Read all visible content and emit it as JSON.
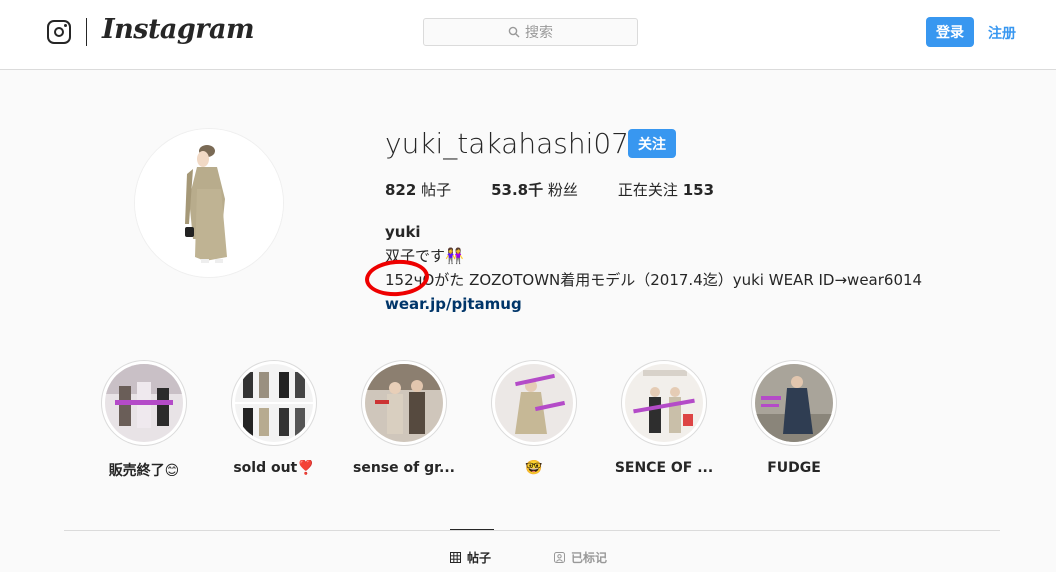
{
  "header": {
    "wordmark": "Instagram",
    "search_placeholder": "搜索",
    "login_label": "登录",
    "signup_label": "注册",
    "accent_color": "#3897f0"
  },
  "profile": {
    "username": "yuki_takahashi0706",
    "follow_label": "关注",
    "stats": {
      "posts_count": "822",
      "posts_label": "帖子",
      "followers_count": "53.8千",
      "followers_label": "粉丝",
      "following_label": "正在关注",
      "following_count": "153"
    },
    "bio": {
      "name": "yuki",
      "line1": "双子です👭",
      "line2": "152чOがた ZOZOTOWN着用モデル（2017.4迄）yuki WEAR ID→wear6014",
      "link": "wear.jp/pjtamug"
    }
  },
  "highlights": [
    {
      "label": "販売終了😊",
      "icon": "highlight-1"
    },
    {
      "label": "sold out❣️",
      "icon": "highlight-2"
    },
    {
      "label": "sense of gr...",
      "icon": "highlight-3"
    },
    {
      "label": "🤓",
      "icon": "highlight-4"
    },
    {
      "label": "SENCE OF ...",
      "icon": "highlight-5"
    },
    {
      "label": "FUDGE",
      "icon": "highlight-6"
    }
  ],
  "tabs": [
    {
      "label": "帖子",
      "icon": "grid-icon",
      "active": true
    },
    {
      "label": "已标记",
      "icon": "tagged-icon",
      "active": false
    }
  ]
}
